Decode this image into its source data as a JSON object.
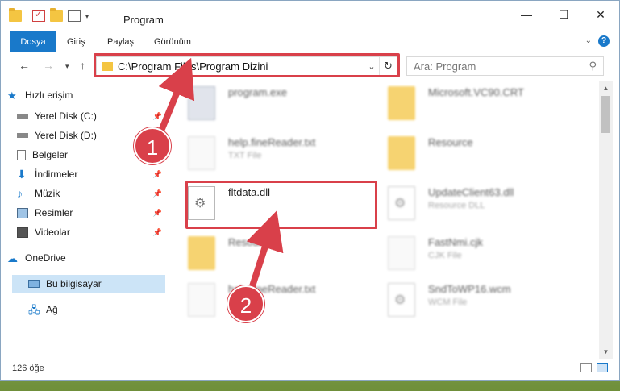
{
  "window": {
    "title": "Program",
    "controls": {
      "minimize": "—",
      "maximize": "☐",
      "close": "✕"
    }
  },
  "ribbon": {
    "tabs": [
      "Dosya",
      "Giriş",
      "Paylaş",
      "Görünüm"
    ],
    "file_tab_color": "#1979ca",
    "help_label": "?"
  },
  "address_bar": {
    "path": "C:\\Program Files\\Program Dizini",
    "search_placeholder": "Ara: Program"
  },
  "sidebar": {
    "items": [
      {
        "label": "Hızlı erişim",
        "icon": "star-icon"
      },
      {
        "label": "Yerel Disk (C:)",
        "icon": "drive-icon",
        "pinned": true
      },
      {
        "label": "Yerel Disk (D:)",
        "icon": "drive-icon",
        "pinned": true
      },
      {
        "label": "Belgeler",
        "icon": "documents-icon",
        "pinned": true
      },
      {
        "label": "İndirmeler",
        "icon": "download-icon",
        "pinned": true
      },
      {
        "label": "Müzik",
        "icon": "music-icon",
        "pinned": true
      },
      {
        "label": "Resimler",
        "icon": "pictures-icon",
        "pinned": true
      },
      {
        "label": "Videolar",
        "icon": "videos-icon",
        "pinned": true
      },
      {
        "label": "OneDrive",
        "icon": "cloud-icon"
      },
      {
        "label": "Bu bilgisayar",
        "icon": "computer-icon",
        "selected": true
      },
      {
        "label": "Ağ",
        "icon": "network-icon"
      }
    ]
  },
  "files": {
    "left": [
      {
        "name": "program.exe",
        "sub": ""
      },
      {
        "name": "help.fineReader.txt",
        "sub": "TXT File"
      },
      {
        "name": "fltdata.dll",
        "sub": ""
      },
      {
        "name": "Resources",
        "sub": ""
      },
      {
        "name": "help.fineReader.txt",
        "sub": ""
      }
    ],
    "right": [
      {
        "name": "Microsoft.VC90.CRT",
        "sub": ""
      },
      {
        "name": "Resource",
        "sub": ""
      },
      {
        "name": "UpdateClient63.dll",
        "sub": "Resource DLL"
      },
      {
        "name": "FastNmi.cjk",
        "sub": "CJK File"
      },
      {
        "name": "SndToWP16.wcm",
        "sub": "WCM File"
      }
    ]
  },
  "status": {
    "count": "126 öğe"
  },
  "annotations": {
    "step1": "1",
    "step2": "2",
    "highlight_color": "#d9404a"
  }
}
